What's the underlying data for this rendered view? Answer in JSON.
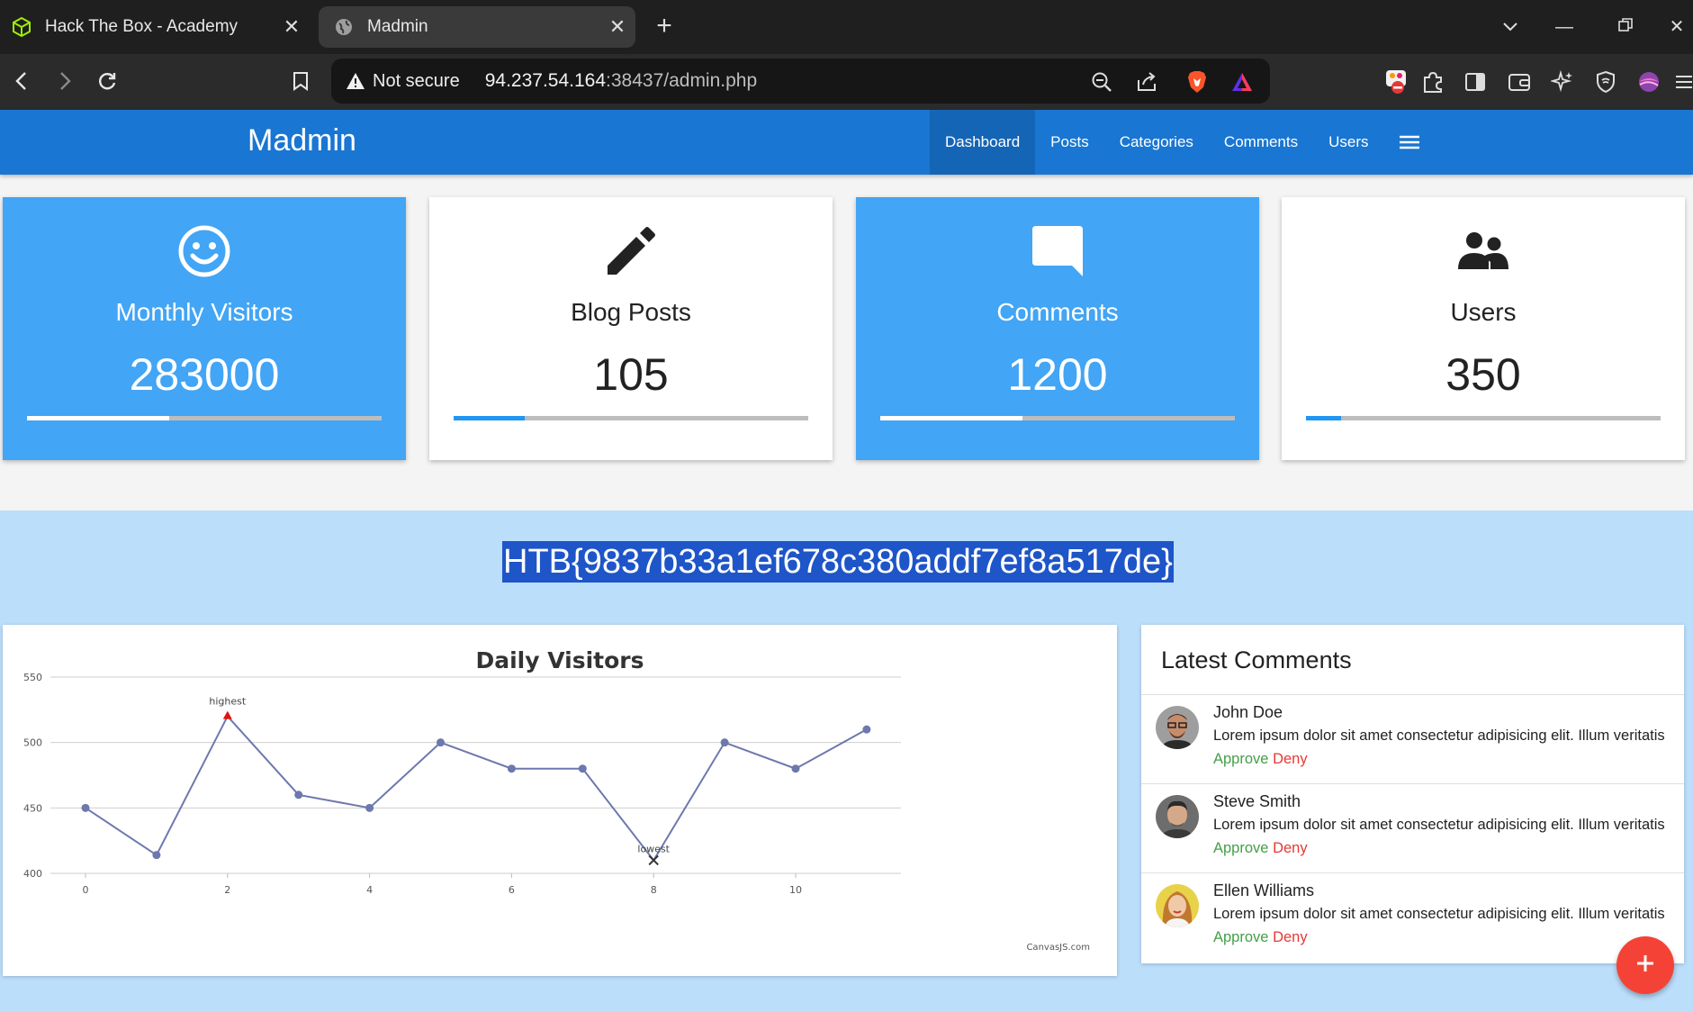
{
  "browser": {
    "tabs": [
      {
        "title": "Hack The Box - Academy",
        "icon": "htb-cube-icon",
        "active": false
      },
      {
        "title": "Madmin",
        "icon": "globe-icon",
        "active": true
      }
    ],
    "address": {
      "security_label": "Not secure",
      "host": "94.237.54.164",
      "path": ":38437/admin.php"
    }
  },
  "navbar": {
    "brand": "Madmin",
    "links": [
      "Dashboard",
      "Posts",
      "Categories",
      "Comments",
      "Users"
    ],
    "active_link": "Dashboard",
    "color": "#1976d2"
  },
  "stats": [
    {
      "title": "Monthly Visitors",
      "value": "283000",
      "icon": "smiley-icon",
      "progress": 0.4,
      "theme": "blue"
    },
    {
      "title": "Blog Posts",
      "value": "105",
      "icon": "pencil-icon",
      "progress": 0.2,
      "theme": "white"
    },
    {
      "title": "Comments",
      "value": "1200",
      "icon": "comment-icon",
      "progress": 0.4,
      "theme": "blue"
    },
    {
      "title": "Users",
      "value": "350",
      "icon": "users-icon",
      "progress": 0.1,
      "theme": "white"
    }
  ],
  "flag_text": "HTB{9837b33a1ef678c380addf7ef8a517de}",
  "chart_data": {
    "type": "line",
    "title": "Daily Visitors",
    "x": [
      0,
      1,
      2,
      3,
      4,
      5,
      6,
      7,
      8,
      9,
      10,
      11
    ],
    "values": [
      450,
      414,
      520,
      460,
      450,
      500,
      480,
      480,
      410,
      500,
      480,
      510
    ],
    "xticks": [
      0,
      2,
      4,
      6,
      8,
      10
    ],
    "yticks": [
      400,
      450,
      500,
      550
    ],
    "ylim": [
      400,
      550
    ],
    "grid": true,
    "annotations": [
      {
        "x": 2,
        "label": "highest"
      },
      {
        "x": 8,
        "label": "lowest"
      }
    ],
    "credit": "CanvasJS.com",
    "line_color": "#6d78ad"
  },
  "latest_comments": {
    "title": "Latest Comments",
    "items": [
      {
        "name": "John Doe",
        "text": "Lorem ipsum dolor sit amet consectetur adipisicing elit. Illum veritatis",
        "approve": "Approve",
        "deny": "Deny"
      },
      {
        "name": "Steve Smith",
        "text": "Lorem ipsum dolor sit amet consectetur adipisicing elit. Illum veritatis",
        "approve": "Approve",
        "deny": "Deny"
      },
      {
        "name": "Ellen Williams",
        "text": "Lorem ipsum dolor sit amet consectetur adipisicing elit. Illum veritatis",
        "approve": "Approve",
        "deny": "Deny"
      }
    ]
  },
  "fab": {
    "icon": "plus-icon",
    "color": "#f44336"
  }
}
